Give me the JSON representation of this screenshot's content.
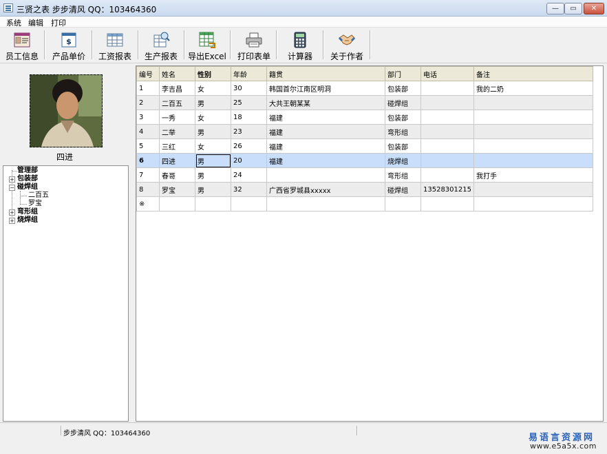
{
  "window": {
    "title": "三贤之表  步步清风  QQ：103464360",
    "min_label": "—",
    "max_label": "▭",
    "close_label": "✕"
  },
  "menu": [
    "系统",
    "编辑",
    "打印"
  ],
  "toolbar": [
    {
      "label": "员工信息",
      "icon": "employee-card-icon"
    },
    {
      "label": "产品单价",
      "icon": "price-dollar-icon"
    },
    {
      "label": "工资报表",
      "icon": "salary-table-icon"
    },
    {
      "label": "生产报表",
      "icon": "production-report-icon"
    },
    {
      "label": "导出Excel",
      "icon": "excel-export-icon"
    },
    {
      "label": "打印表单",
      "icon": "printer-icon"
    },
    {
      "label": "计算器",
      "icon": "calculator-icon"
    },
    {
      "label": "关于作者",
      "icon": "handshake-icon"
    }
  ],
  "profile": {
    "name": "四进"
  },
  "tree": [
    {
      "label": "管理部",
      "bold": true,
      "expander": ""
    },
    {
      "label": "包装部",
      "bold": true,
      "expander": "+"
    },
    {
      "label": "碰焊组",
      "bold": true,
      "expander": "−"
    },
    {
      "label": "二百五",
      "bold": false,
      "expander": ""
    },
    {
      "label": "罗宝",
      "bold": false,
      "expander": ""
    },
    {
      "label": "弯形组",
      "bold": true,
      "expander": "+"
    },
    {
      "label": "烧焊组",
      "bold": true,
      "expander": "+"
    }
  ],
  "grid": {
    "columns": [
      "编号",
      "姓名",
      "性别",
      "年龄",
      "籍贯",
      "部门",
      "电话",
      "备注"
    ],
    "rows": [
      [
        "1",
        "李吉昌",
        "女",
        "30",
        "韩国首尔江南区明洞",
        "包装部",
        "",
        "我的二奶"
      ],
      [
        "2",
        "二百五",
        "男",
        "25",
        "大共王朝某某",
        "碰焊组",
        "",
        ""
      ],
      [
        "3",
        "一秀",
        "女",
        "18",
        "福建",
        "包装部",
        "",
        ""
      ],
      [
        "4",
        "二举",
        "男",
        "23",
        "福建",
        "弯形组",
        "",
        ""
      ],
      [
        "5",
        "三红",
        "女",
        "26",
        "福建",
        "包装部",
        "",
        ""
      ],
      [
        "6",
        "四进",
        "男",
        "20",
        "福建",
        "烧焊组",
        "",
        ""
      ],
      [
        "7",
        "春哥",
        "男",
        "24",
        "",
        "弯形组",
        "",
        "我打手"
      ],
      [
        "8",
        "罗宝",
        "男",
        "32",
        "广西省罗城县xxxxx",
        "碰焊组",
        "13528301215",
        ""
      ]
    ],
    "new_row_marker": "※",
    "selected_row": 6
  },
  "status": {
    "text": "步步清风   QQ：103464360"
  },
  "watermark": {
    "cn": "易语言资源网",
    "url": "www.e5a5x.com"
  },
  "colors": {
    "selected_row": "#c8defa",
    "alt_row": "#ececec",
    "header": "#ece9d8",
    "watermark": "#2a63b8"
  }
}
